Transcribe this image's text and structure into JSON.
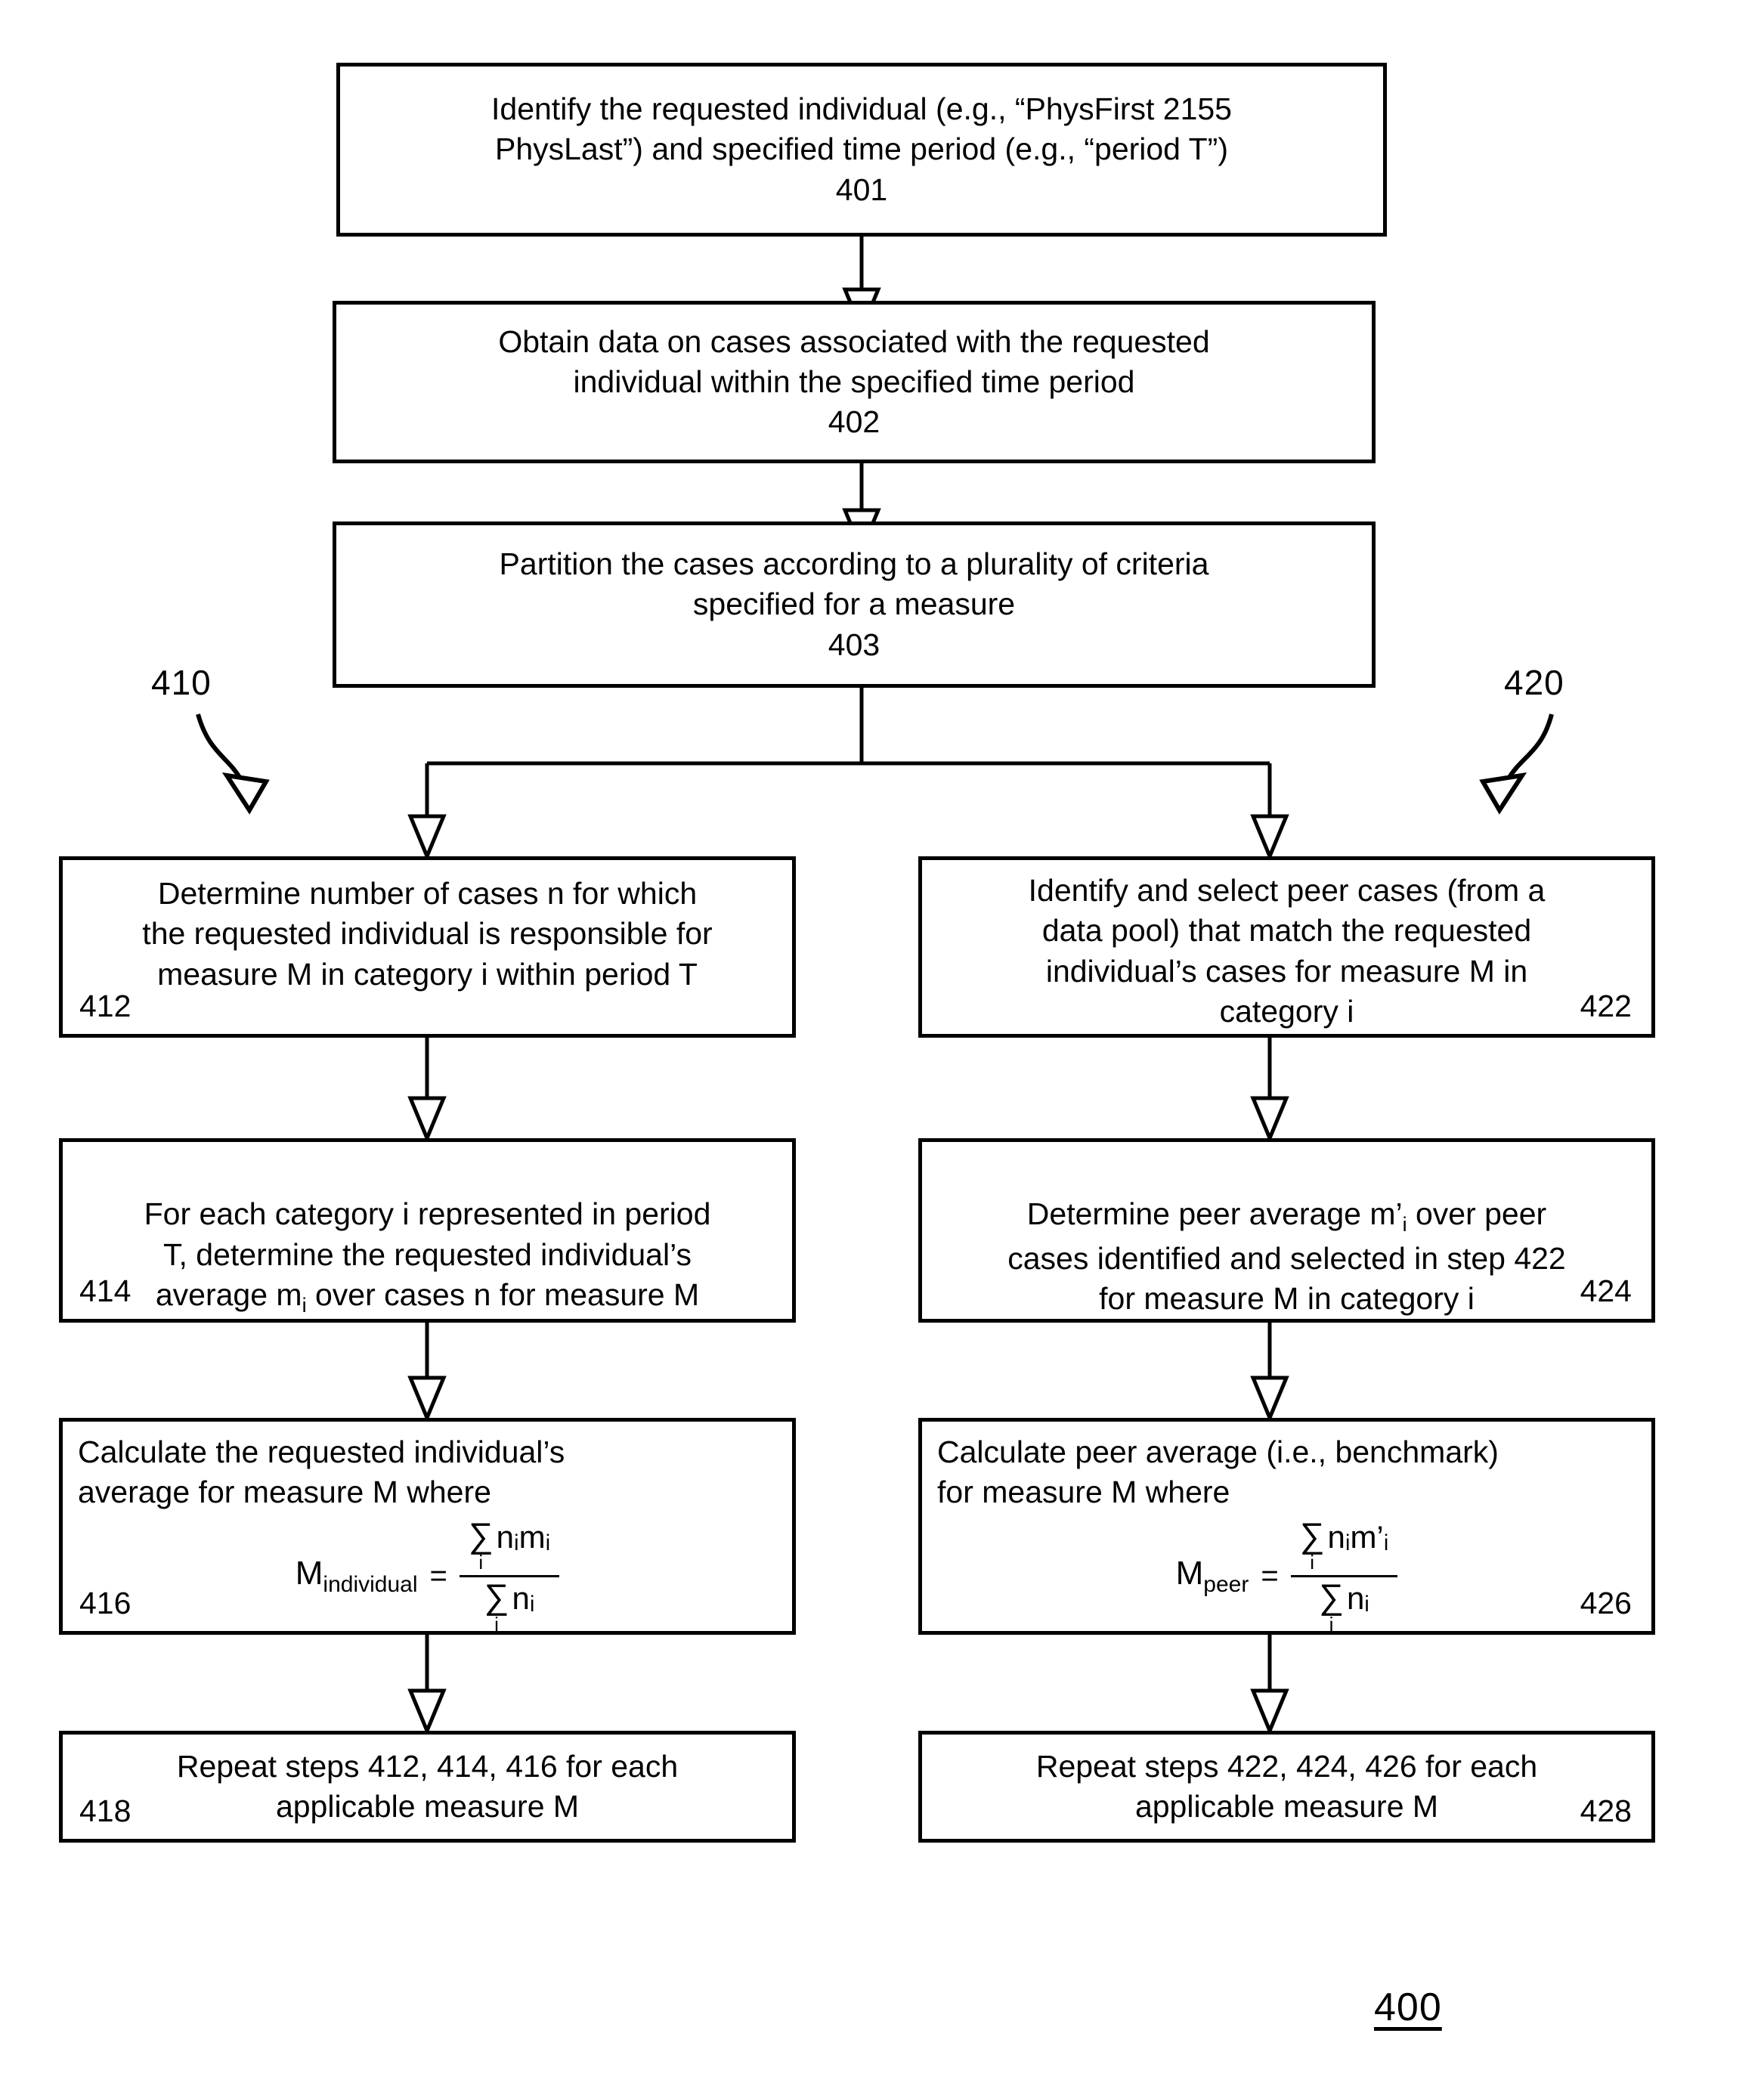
{
  "figure": {
    "label": "400"
  },
  "branches": [
    {
      "id": "410",
      "label": "410"
    },
    {
      "id": "420",
      "label": "420"
    }
  ],
  "boxes": {
    "b401": {
      "text": "Identify the requested individual (e.g., “PhysFirst 2155\nPhysLast”) and specified time period (e.g., “period T”)",
      "number": "401"
    },
    "b402": {
      "text": "Obtain data on cases associated with the requested\nindividual within the specified time period",
      "number": "402"
    },
    "b403": {
      "text": "Partition the cases according to a plurality of criteria\nspecified for a measure",
      "number": "403"
    },
    "b412": {
      "text": "Determine number of cases n for which\nthe requested individual is responsible for\nmeasure M in category i within period T",
      "number": "412"
    },
    "b422": {
      "text": "Identify and select peer cases (from a\ndata pool) that match the requested\nindividual’s cases for measure M in\ncategory i",
      "number": "422"
    },
    "b414": {
      "text": "For each category i represented in period\nT, determine the requested individual’s\naverage m",
      "text_sub": "i",
      "text_tail": " over cases n for measure M",
      "number": "414"
    },
    "b424": {
      "text": "Determine peer average m’",
      "text_sub": "i",
      "text_tail": " over peer\ncases identified and selected in step 422\nfor measure M in category i",
      "number": "424"
    },
    "b416": {
      "text": "Calculate the requested individual’s\naverage for measure M where",
      "number": "416",
      "formula": {
        "lhs": "M",
        "lhs_sub": "individual",
        "numerator_sum": "∑",
        "numerator_index": "i",
        "numerator_term": "nᵢmᵢ",
        "denominator_sum": "∑",
        "denominator_index": "i",
        "denominator_term": "nᵢ"
      }
    },
    "b426": {
      "text": "Calculate peer average (i.e., benchmark)\nfor measure M where",
      "number": "426",
      "formula": {
        "lhs": "M",
        "lhs_sub": "peer",
        "numerator_sum": "∑",
        "numerator_index": "i",
        "numerator_term": "nᵢm’ᵢ",
        "denominator_sum": "∑",
        "denominator_index": "i",
        "denominator_term": "nᵢ"
      }
    },
    "b418": {
      "text": "Repeat steps 412, 414, 416 for each\napplicable measure M",
      "number": "418"
    },
    "b428": {
      "text": "Repeat steps 422, 424, 426 for each\napplicable measure M",
      "number": "428"
    }
  }
}
